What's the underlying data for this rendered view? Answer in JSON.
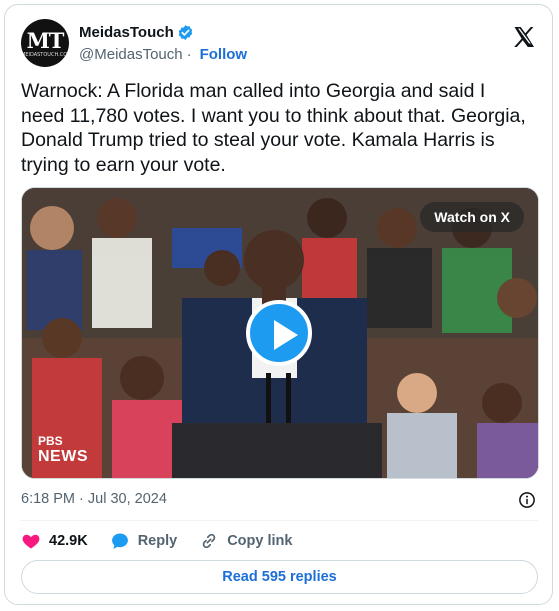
{
  "account": {
    "name": "MeidasTouch",
    "handle": "@MeidasTouch",
    "separator": "·",
    "follow_label": "Follow",
    "avatar_text": "MT",
    "avatar_subtext": "MEIDASTOUCH.COM"
  },
  "tweet": {
    "text": "Warnock: A Florida man called into Georgia and said I need 11,780 votes. I want you to think about that. Georgia, Donald Trump tried to steal your vote. Kamala Harris is trying to earn your vote.",
    "timestamp": "6:18 PM · Jul 30, 2024"
  },
  "media": {
    "watch_label": "Watch on X",
    "network_top": "PBS",
    "network_bottom": "NEWS"
  },
  "actions": {
    "likes": "42.9K",
    "reply_label": "Reply",
    "copy_label": "Copy link"
  },
  "replies_button": "Read 595 replies",
  "colors": {
    "link_blue": "#1d6fd8",
    "verified_blue": "#1d9bf0",
    "like_pink": "#f91880",
    "muted_text": "#536471"
  },
  "icons": [
    "verified-badge-icon",
    "x-logo-icon",
    "play-icon",
    "info-icon",
    "heart-icon",
    "reply-bubble-icon",
    "link-icon"
  ]
}
